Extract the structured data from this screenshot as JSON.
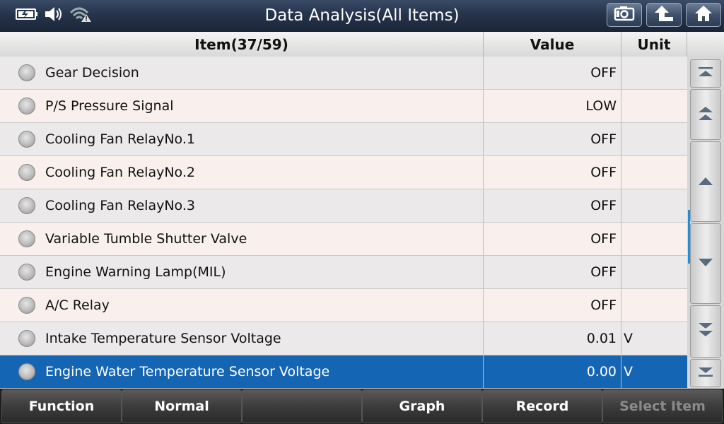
{
  "header": {
    "title": "Data Analysis(All Items)",
    "status_icons": [
      "battery-icon",
      "speaker-icon",
      "wifi-warning-icon"
    ],
    "buttons": [
      "screenshot-icon",
      "back-icon",
      "home-icon"
    ]
  },
  "table": {
    "columns": {
      "item": "Item(37/59)",
      "value": "Value",
      "unit": "Unit"
    },
    "rows": [
      {
        "item": "Gear Decision",
        "value": "OFF",
        "unit": ""
      },
      {
        "item": "P/S Pressure Signal",
        "value": "LOW",
        "unit": ""
      },
      {
        "item": "Cooling Fan RelayNo.1",
        "value": "OFF",
        "unit": ""
      },
      {
        "item": "Cooling Fan RelayNo.2",
        "value": "OFF",
        "unit": ""
      },
      {
        "item": "Cooling Fan RelayNo.3",
        "value": "OFF",
        "unit": ""
      },
      {
        "item": "Variable Tumble Shutter Valve",
        "value": "OFF",
        "unit": ""
      },
      {
        "item": "Engine Warning Lamp(MIL)",
        "value": "OFF",
        "unit": ""
      },
      {
        "item": "A/C Relay",
        "value": "OFF",
        "unit": ""
      },
      {
        "item": "Intake Temperature Sensor Voltage",
        "value": "0.01",
        "unit": "V"
      },
      {
        "item": "Engine Water Temperature Sensor Voltage",
        "value": "0.00",
        "unit": "V"
      }
    ],
    "selected_row": 9,
    "selected_color": "#1565b5"
  },
  "scroll_buttons": [
    "scroll-top-icon",
    "page-up-icon",
    "line-up-icon",
    "line-down-icon",
    "page-down-icon",
    "scroll-bottom-icon"
  ],
  "footer": {
    "function": "Function",
    "normal": "Normal",
    "empty": "",
    "graph": "Graph",
    "record": "Record",
    "select_item": "Select Item"
  }
}
